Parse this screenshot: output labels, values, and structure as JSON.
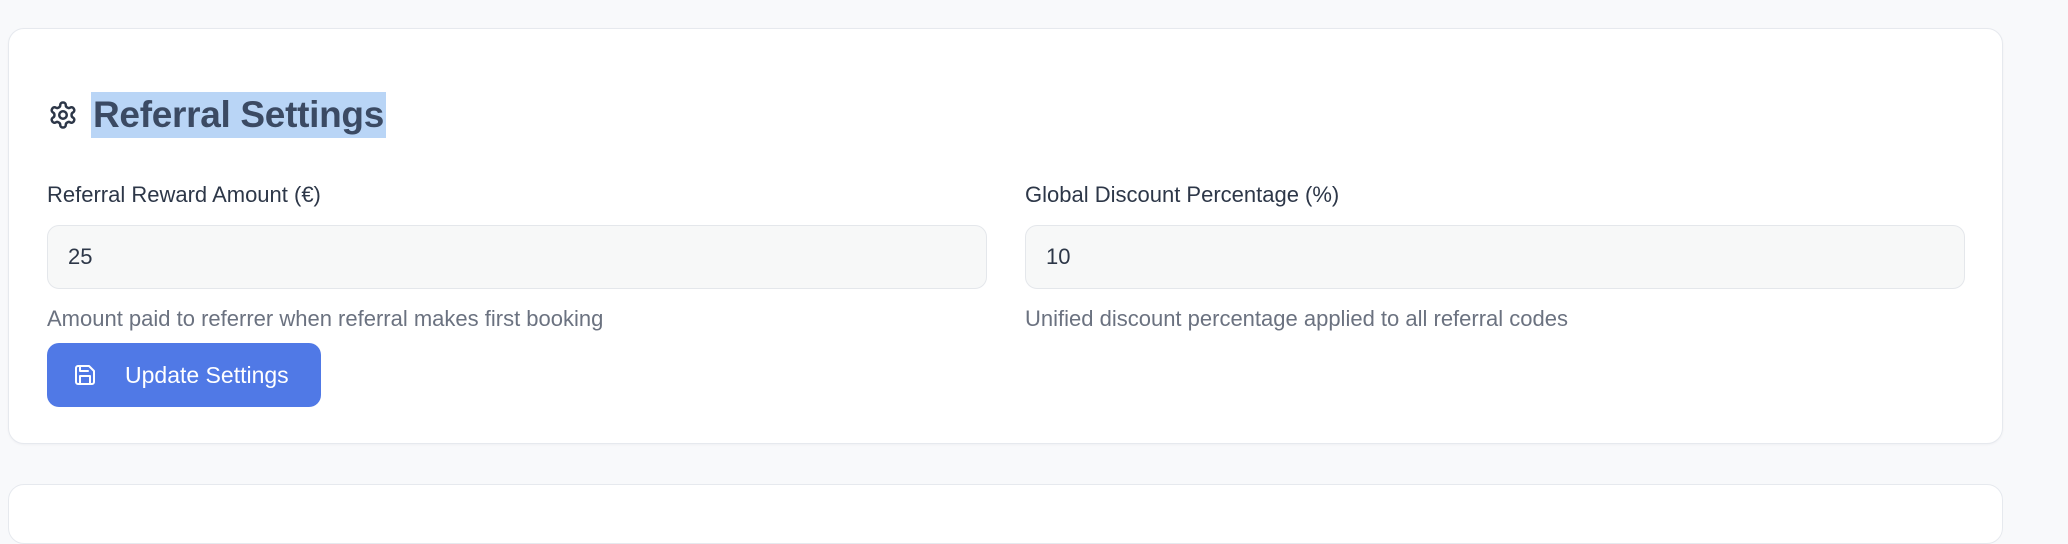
{
  "settings": {
    "title": "Referral Settings",
    "title_icon": "gear-icon",
    "fields": [
      {
        "label": "Referral Reward Amount (€)",
        "value": "25",
        "help": "Amount paid to referrer when referral makes first booking"
      },
      {
        "label": "Global Discount Percentage (%)",
        "value": "10",
        "help": "Unified discount percentage applied to all referral codes"
      }
    ],
    "update_button": {
      "label": "Update Settings",
      "icon": "save-icon"
    }
  },
  "colors": {
    "accent": "#5079e6",
    "title_highlight": "#b9d5f6",
    "background": "#f8f9fb"
  }
}
